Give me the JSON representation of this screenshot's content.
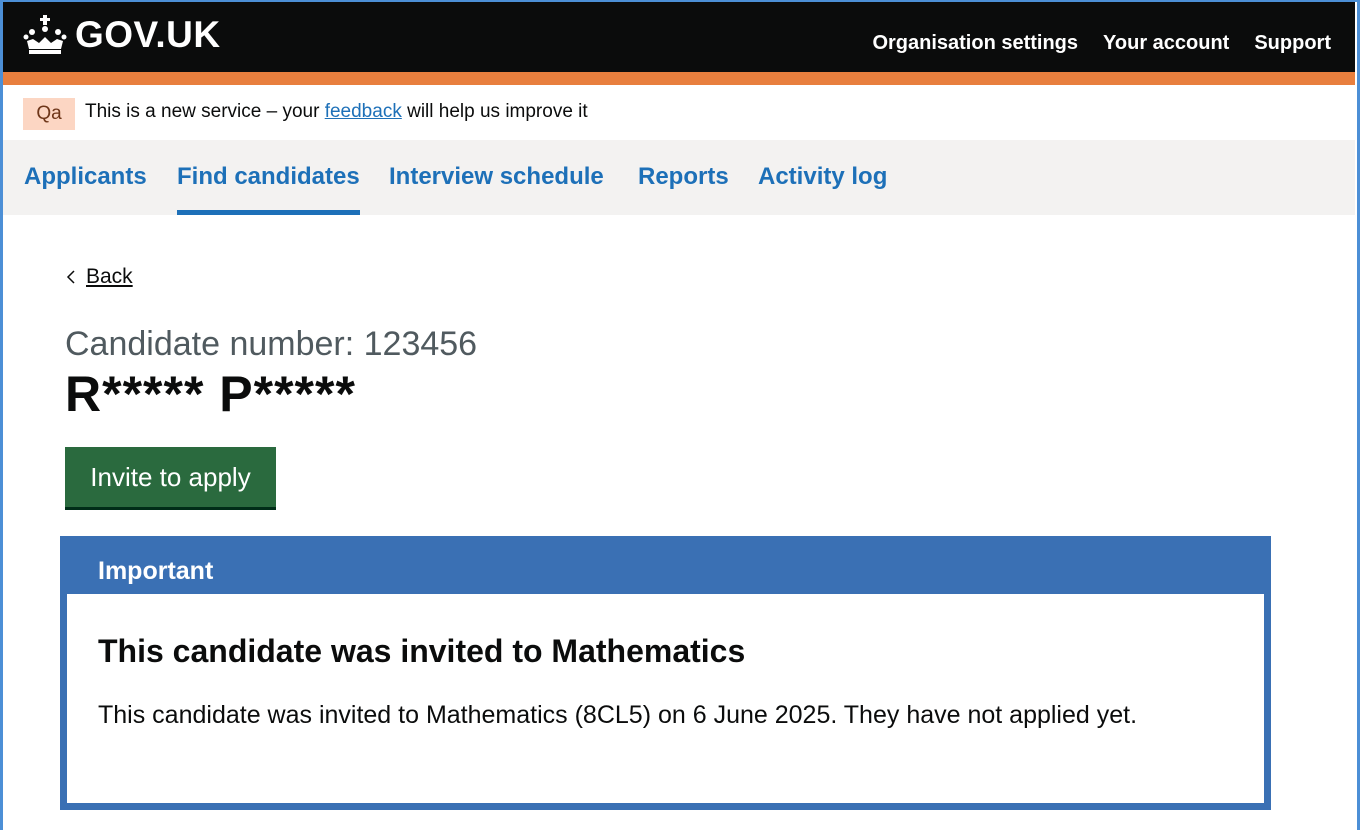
{
  "header": {
    "logo_text": "GOV.UK",
    "logo_icon": "crown-icon",
    "links": [
      "Organisation settings",
      "Your account",
      "Support"
    ]
  },
  "phase_banner": {
    "tag": "Qa",
    "text_before": "This is a new service – your ",
    "link": "feedback",
    "text_after": " will help us improve it"
  },
  "nav": {
    "items": [
      "Applicants",
      "Find candidates",
      "Interview schedule",
      "Reports",
      "Activity log"
    ],
    "active": "Find candidates"
  },
  "back_link": "Back",
  "candidate": {
    "caption": "Candidate number: 123456",
    "name": "R***** P*****"
  },
  "invite_button": "Invite to apply",
  "notification": {
    "heading": "Important",
    "title": "This candidate was invited to Mathematics",
    "body": "This candidate was invited to Mathematics (8CL5) on 6 June 2025. They have not applied yet."
  },
  "colors": {
    "header_bg": "#0b0c0c",
    "accent_orange": "#e87f3e",
    "link_blue": "#1d70b8",
    "button_green": "#2a6a3e",
    "banner_blue": "#3a70b4"
  }
}
